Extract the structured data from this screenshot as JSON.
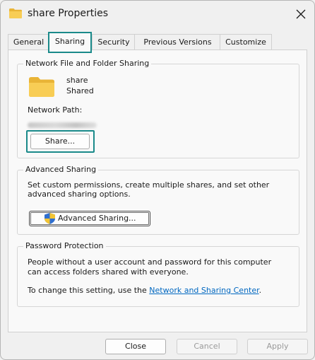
{
  "window": {
    "title": "share Properties"
  },
  "tabs": [
    {
      "label": "General"
    },
    {
      "label": "Sharing"
    },
    {
      "label": "Security"
    },
    {
      "label": "Previous Versions"
    },
    {
      "label": "Customize"
    }
  ],
  "network_sharing": {
    "legend": "Network File and Folder Sharing",
    "folder_name": "share",
    "folder_status": "Shared",
    "path_label": "Network Path:",
    "share_button": "Share..."
  },
  "advanced_sharing": {
    "legend": "Advanced Sharing",
    "description_line1": "Set custom permissions, create multiple shares, and set other",
    "description_line2": "advanced sharing options.",
    "button": "Advanced Sharing..."
  },
  "password_protection": {
    "legend": "Password Protection",
    "line1": "People without a user account and password for this computer",
    "line2": "can access folders shared with everyone.",
    "change_prefix": "To change this setting, use the",
    "link": "Network and Sharing Center",
    "change_suffix": "."
  },
  "footer": {
    "close": "Close",
    "cancel": "Cancel",
    "apply": "Apply"
  },
  "colors": {
    "accent_highlight": "#1a8a8a",
    "link": "#0067c0",
    "folder": "#f6c94d"
  }
}
